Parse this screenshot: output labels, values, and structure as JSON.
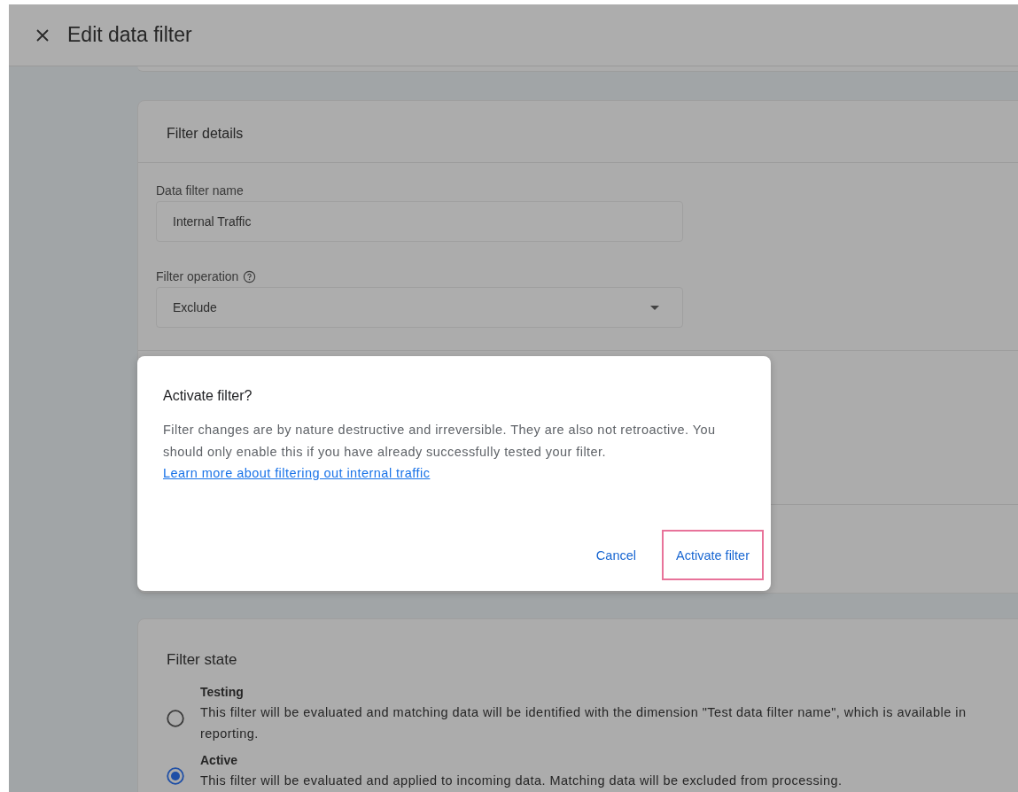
{
  "header": {
    "title": "Edit data filter"
  },
  "filter_details": {
    "title": "Filter details",
    "fields": [
      {
        "kind": "text",
        "label": "Data filter name",
        "help": false,
        "value": "Internal Traffic"
      },
      {
        "kind": "select",
        "label": "Filter operation",
        "help": true,
        "value": "Exclude"
      }
    ]
  },
  "filter_state": {
    "title": "Filter state",
    "options": [
      {
        "label": "Testing",
        "description": "This filter will be evaluated and matching data will be identified with the dimension \"Test data filter name\", which is available in reporting.",
        "selected": false
      },
      {
        "label": "Active",
        "description": "This filter will be evaluated and applied to incoming data. Matching data will be excluded from processing.",
        "selected": true
      }
    ]
  },
  "dialog": {
    "title": "Activate filter?",
    "body": "Filter changes are by nature destructive and irreversible. They are also not retroactive. You should only enable this if you have already successfully tested your filter.",
    "link": "Learn more about filtering out internal traffic",
    "buttons": [
      {
        "label": "Cancel",
        "highlighted": false
      },
      {
        "label": "Activate filter",
        "highlighted": true
      }
    ]
  }
}
